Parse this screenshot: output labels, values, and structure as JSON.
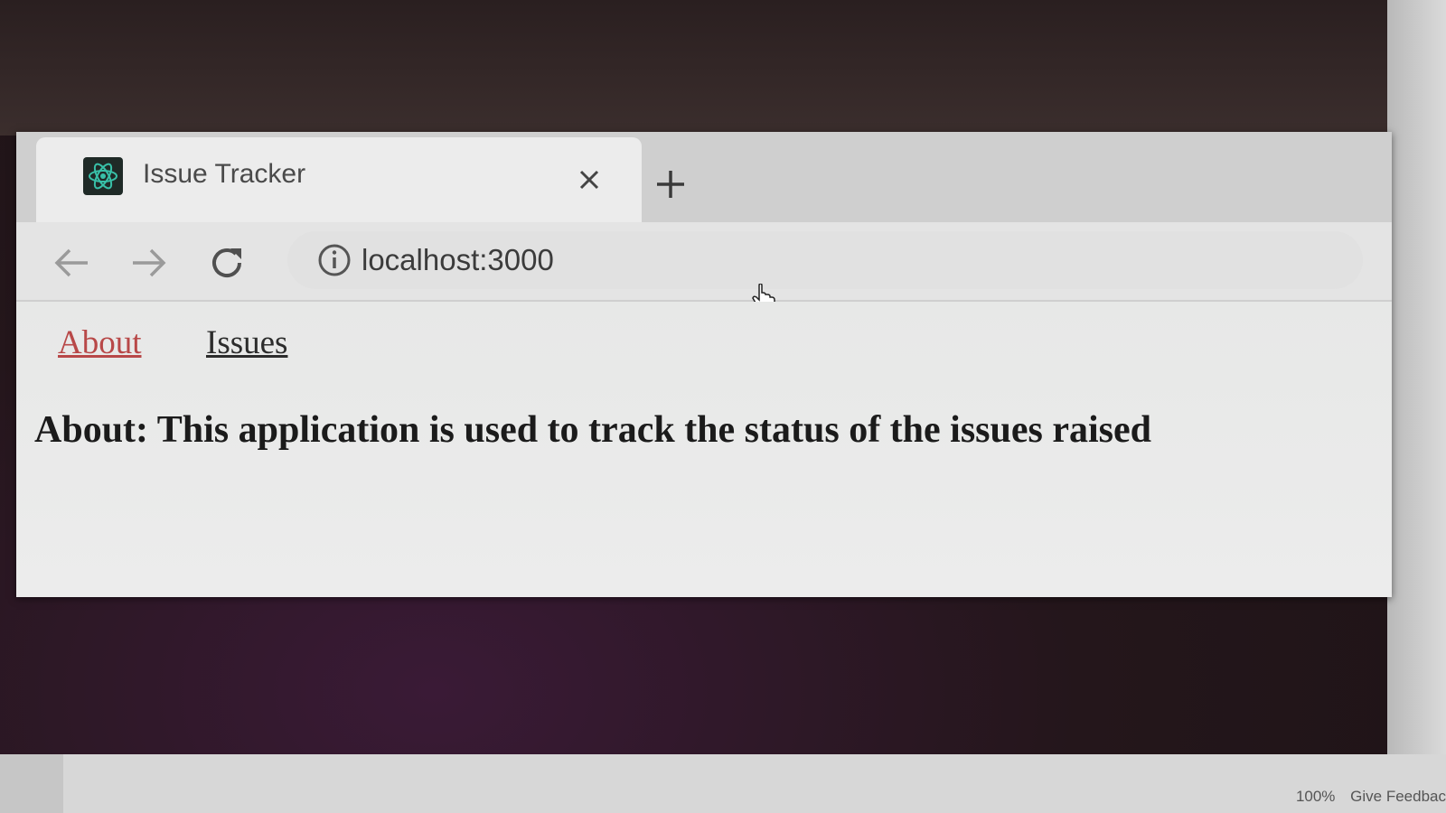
{
  "browser": {
    "tab": {
      "title": "Issue Tracker",
      "favicon": "react-atom-icon"
    },
    "new_tab_icon": "plus-icon",
    "close_icon": "close-icon",
    "toolbar": {
      "back_icon": "arrow-left-icon",
      "forward_icon": "arrow-right-icon",
      "reload_icon": "reload-icon",
      "site_info_icon": "info-icon",
      "url": "localhost:3000"
    }
  },
  "page": {
    "nav": [
      {
        "label": "About",
        "active": true
      },
      {
        "label": "Issues",
        "active": false
      }
    ],
    "about_text": "About: This application is used to track the status of the issues raised"
  },
  "status_bar": {
    "zoom": "100%",
    "feedback": "Give Feedbac"
  },
  "colors": {
    "active_link": "#b84848",
    "link": "#2c2c2c",
    "favicon_bg": "#1f2a27",
    "react_teal": "#38c0a8"
  }
}
